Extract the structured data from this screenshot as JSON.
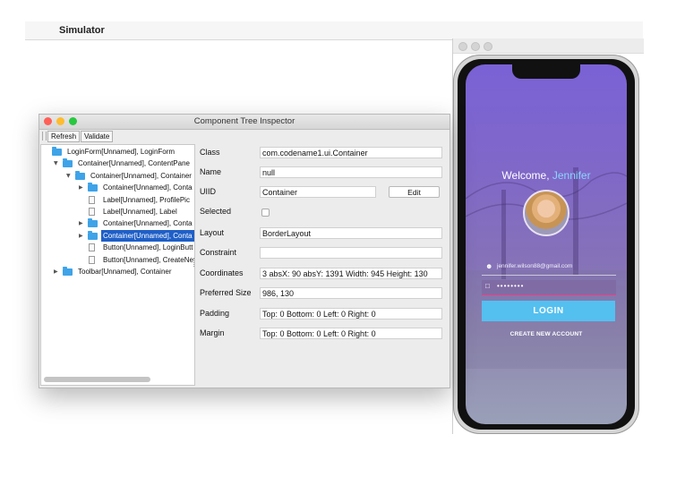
{
  "menubar": {
    "apple_glyph": "",
    "app_name": "Simulator"
  },
  "inspector": {
    "title": "Component Tree Inspector",
    "toolbar": {
      "refresh": "Refresh",
      "validate": "Validate"
    },
    "tree": [
      {
        "label": "LoginForm[Unnamed], LoginForm",
        "level": 0,
        "arrow": "",
        "icon": "folder",
        "selected": false
      },
      {
        "label": "Container[Unnamed], ContentPane",
        "level": 1,
        "arrow": "▼",
        "icon": "folder",
        "selected": false
      },
      {
        "label": "Container[Unnamed], Container",
        "level": 2,
        "arrow": "▼",
        "icon": "folder",
        "selected": false
      },
      {
        "label": "Container[Unnamed], Conta",
        "level": 3,
        "arrow": "▶",
        "icon": "folder",
        "selected": false
      },
      {
        "label": "Label[Unnamed], ProfilePic",
        "level": 3,
        "arrow": "",
        "icon": "doc",
        "selected": false
      },
      {
        "label": "Label[Unnamed], Label",
        "level": 3,
        "arrow": "",
        "icon": "doc",
        "selected": false
      },
      {
        "label": "Container[Unnamed], Conta",
        "level": 3,
        "arrow": "▶",
        "icon": "folder",
        "selected": false
      },
      {
        "label": "Container[Unnamed], Conta",
        "level": 3,
        "arrow": "▶",
        "icon": "folder",
        "selected": true
      },
      {
        "label": "Button[Unnamed], LoginButt",
        "level": 3,
        "arrow": "",
        "icon": "doc",
        "selected": false
      },
      {
        "label": "Button[Unnamed], CreateNe",
        "level": 3,
        "arrow": "",
        "icon": "doc",
        "selected": false
      },
      {
        "label": "Toolbar[Unnamed], Container",
        "level": 1,
        "arrow": "▶",
        "icon": "folder",
        "selected": false
      }
    ],
    "props": {
      "class_label": "Class",
      "class_value": "com.codename1.ui.Container",
      "name_label": "Name",
      "name_value": "null",
      "uiid_label": "UIID",
      "uiid_value": "Container",
      "edit_button": "Edit",
      "selected_label": "Selected",
      "selected_checked": false,
      "layout_label": "Layout",
      "layout_value": "BorderLayout",
      "constraint_label": "Constraint",
      "constraint_value": "",
      "coordinates_label": "Coordinates",
      "coordinates_value": "3 absX: 90 absY: 1391 Width: 945 Height: 130",
      "preferred_label": "Preferred Size",
      "preferred_value": "986, 130",
      "padding_label": "Padding",
      "padding_value": "Top: 0 Bottom: 0 Left: 0 Right: 0",
      "margin_label": "Margin",
      "margin_value": "Top: 0 Bottom: 0 Left: 0 Right: 0"
    }
  },
  "phone": {
    "welcome_prefix": "Welcome, ",
    "welcome_name": "Jennifer",
    "email_value": "jennifer.wilson88@gmail.com",
    "password_mask": "••••••••",
    "login_button": "LOGIN",
    "create_account": "CREATE NEW ACCOUNT"
  },
  "colors": {
    "selection": "#1f5fc7",
    "folder": "#3ea3e8",
    "login_button": "#54c0f0",
    "welcome_name": "#8ad6ff",
    "password_underline": "#e04488",
    "traffic_red": "#fe5f57",
    "traffic_yellow": "#febc2e",
    "traffic_green": "#28c840"
  }
}
